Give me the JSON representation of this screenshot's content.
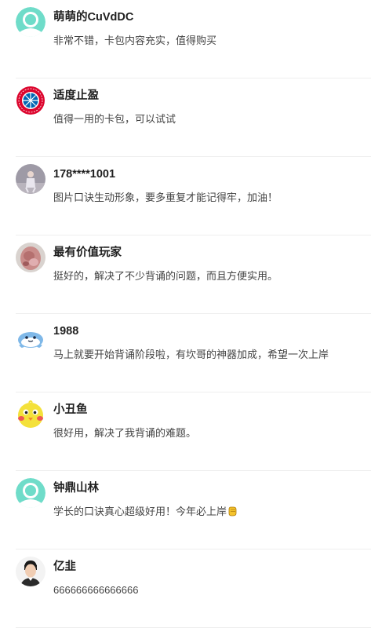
{
  "comments": [
    {
      "name": "萌萌的CuVdDC",
      "text": "非常不错，卡包内容充实，值得购买",
      "avatar": "default-user-avatar"
    },
    {
      "name": "适度止盈",
      "text": "值得一用的卡包，可以试试",
      "avatar": "bayern-logo-avatar"
    },
    {
      "name": "178****1001",
      "text": "图片口诀生动形象，要多重复才能记得牢，加油！",
      "avatar": "photo-avatar"
    },
    {
      "name": "最有价值玩家",
      "text": "挺好的，解决了不少背诵的问题，而且方便实用。",
      "avatar": "photo-avatar"
    },
    {
      "name": "1988",
      "text": "马上就要开始背诵阶段啦，有坎哥的神器加成，希望一次上岸",
      "avatar": "cartoon-penguin-avatar"
    },
    {
      "name": "小丑鱼",
      "text": "很好用，解决了我背诵的难题。",
      "avatar": "cartoon-chick-avatar"
    },
    {
      "name": "钟鼎山林",
      "text": "学长的口诀真心超级好用！今年必上岸",
      "avatar": "default-user-avatar",
      "trailing_icon": "fist-emoji-icon"
    },
    {
      "name": "亿韭",
      "text": "666666666666666",
      "avatar": "photo-avatar"
    }
  ],
  "colors": {
    "default_avatar": "#6fdcc9",
    "divider": "#eeeeee",
    "name": "#1f1f1f",
    "text": "#444444"
  }
}
